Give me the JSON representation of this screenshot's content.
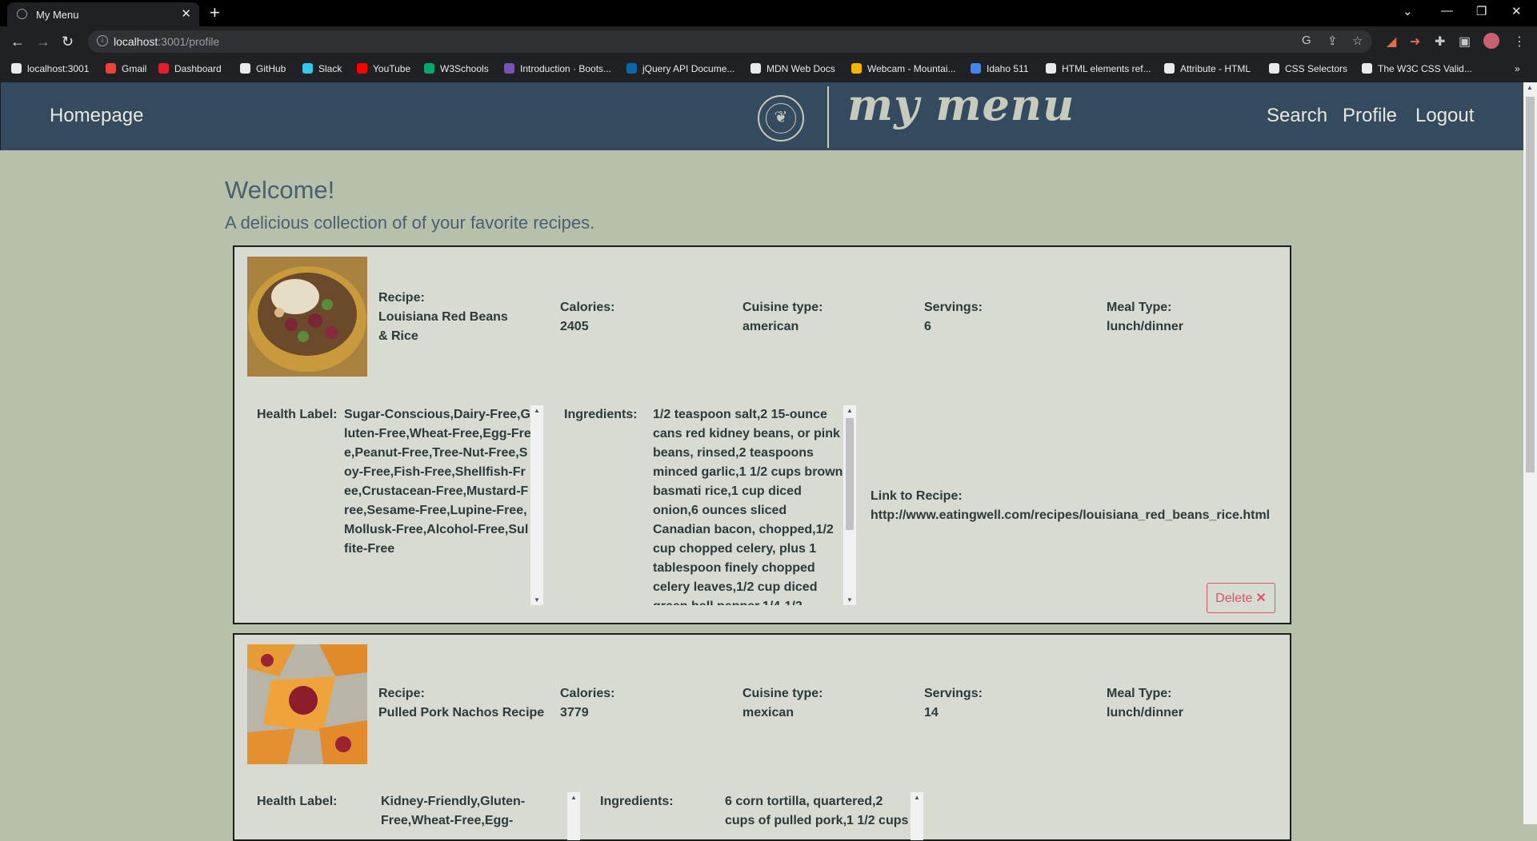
{
  "browser": {
    "tab_title": "My Menu",
    "url_host": "localhost",
    "url_rest": ":3001/profile",
    "bookmarks": [
      {
        "label": "localhost:3001",
        "color": "#e8eaed"
      },
      {
        "label": "Gmail",
        "color": "#ea4335"
      },
      {
        "label": "Dashboard",
        "color": "#e01e2c"
      },
      {
        "label": "GitHub",
        "color": "#e8eaed"
      },
      {
        "label": "Slack",
        "color": "#36c5f0"
      },
      {
        "label": "YouTube",
        "color": "#ff0000"
      },
      {
        "label": "W3Schools",
        "color": "#04aa6d"
      },
      {
        "label": "Introduction · Boots...",
        "color": "#7952b3"
      },
      {
        "label": "jQuery API Docume...",
        "color": "#0769ad"
      },
      {
        "label": "MDN Web Docs",
        "color": "#e8eaed"
      },
      {
        "label": "Webcam - Mountai...",
        "color": "#f4b400"
      },
      {
        "label": "Idaho 511",
        "color": "#4285f4"
      },
      {
        "label": "HTML elements ref...",
        "color": "#e8eaed"
      },
      {
        "label": "Attribute - HTML",
        "color": "#e8eaed"
      },
      {
        "label": "CSS Selectors",
        "color": "#e8eaed"
      },
      {
        "label": "The W3C CSS Valid...",
        "color": "#e8eaed"
      }
    ]
  },
  "header": {
    "home_label": "Homepage",
    "logo_text": "my menu",
    "search_label": "Search",
    "profile_label": "Profile",
    "logout_label": "Logout"
  },
  "page": {
    "welcome": "Welcome!",
    "subtitle": "A delicious collection of of your favorite recipes."
  },
  "labels": {
    "recipe": "Recipe:",
    "calories": "Calories:",
    "cuisine": "Cuisine type:",
    "servings": "Servings:",
    "meal": "Meal Type:",
    "health": "Health Label:",
    "ingredients": "Ingredients:",
    "link": "Link to Recipe:",
    "delete": "Delete"
  },
  "recipes": [
    {
      "name": "Louisiana Red Beans & Rice",
      "calories": "2405",
      "cuisine": "american",
      "servings": "6",
      "meal_type": "lunch/dinner",
      "health_labels": "Sugar-Conscious,Dairy-Free,Gluten-Free,Wheat-Free,Egg-Free,Peanut-Free,Tree-Nut-Free,Soy-Free,Fish-Free,Shellfish-Free,Crustacean-Free,Mustard-Free,Sesame-Free,Lupine-Free,Mollusk-Free,Alcohol-Free,Sulfite-Free",
      "ingredients": "1/2 teaspoon salt,2 15-ounce cans red kidney beans, or pink beans, rinsed,2 teaspoons minced garlic,1 1/2 cups brown basmati rice,1 cup diced onion,6 ounces sliced Canadian bacon, chopped,1/2 cup chopped celery, plus 1 tablespoon finely chopped celery leaves,1/2 cup diced green bell pepper,1/4-1/2",
      "link": "http://www.eatingwell.com/recipes/louisiana_red_beans_rice.html"
    },
    {
      "name": "Pulled Pork Nachos Recipe",
      "calories": "3779",
      "cuisine": "mexican",
      "servings": "14",
      "meal_type": "lunch/dinner",
      "health_labels": "Kidney-Friendly,Gluten-Free,Wheat-Free,Egg-",
      "ingredients": "6 corn tortilla, quartered,2 cups of pulled pork,1 1/2 cups"
    }
  ]
}
